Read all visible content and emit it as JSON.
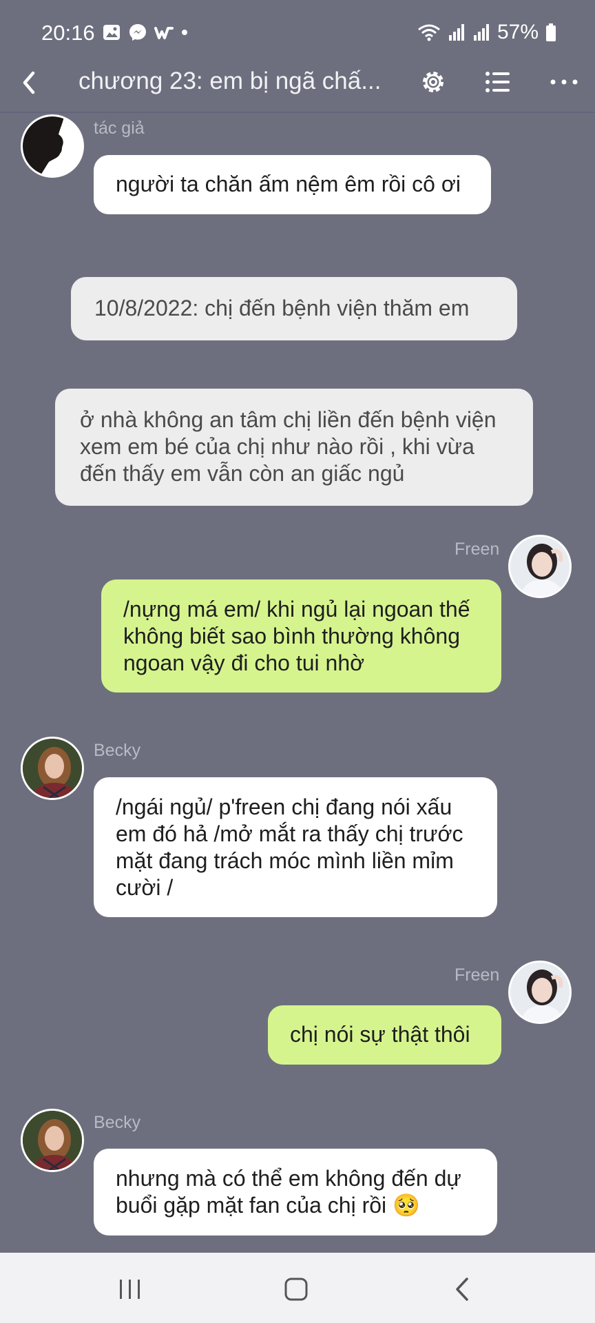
{
  "status_bar": {
    "time": "20:16",
    "battery": "57%",
    "left_icons": [
      "gallery-icon",
      "messenger-icon",
      "wattpad-icon",
      "dot-icon"
    ],
    "right_icons": [
      "wifi-icon",
      "signal-icon",
      "signal-icon",
      "battery-icon"
    ]
  },
  "header": {
    "title": "chương 23: em bị ngã chấ..."
  },
  "messages": [
    {
      "type": "left",
      "name": "tác giả",
      "text": "người ta chăn ấm nệm êm rồi cô ơi"
    },
    {
      "type": "center",
      "text": "10/8/2022: chị đến bệnh viện thăm em"
    },
    {
      "type": "center",
      "text": "ở nhà không an tâm chị liền đến bệnh viện xem em bé của chị như nào rồi , khi vừa đến thấy em vẫn còn an giấc ngủ"
    },
    {
      "type": "right",
      "name": "Freen",
      "text": "/nựng má em/ khi ngủ lại ngoan thế không biết sao bình thường không ngoan vậy đi cho tui nhờ"
    },
    {
      "type": "left",
      "name": "Becky",
      "text": "/ngái ngủ/ p'freen chị đang nói xấu em đó hả /mở mắt ra thấy chị trước mặt đang trách móc mình liền mỉm cười /"
    },
    {
      "type": "right",
      "name": "Freen",
      "text": "chị nói sự thật thôi"
    },
    {
      "type": "left",
      "name": "Becky",
      "text": "nhưng mà có thể em không đến dự buổi gặp mặt fan của chị rồi 🥺"
    }
  ],
  "colors": {
    "background": "#6e6f7e",
    "bubble_white": "#ffffff",
    "bubble_green": "#d6f48e",
    "bubble_grey": "#ededee"
  }
}
